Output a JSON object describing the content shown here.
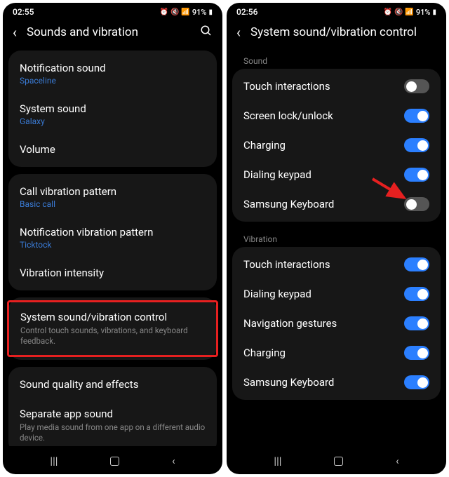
{
  "left": {
    "status": {
      "time": "02:55",
      "battery": "91%"
    },
    "header": {
      "title": "Sounds and vibration"
    },
    "groups": [
      [
        {
          "title": "Notification sound",
          "sub": "Spaceline"
        },
        {
          "title": "System sound",
          "sub": "Galaxy"
        },
        {
          "title": "Volume"
        }
      ],
      [
        {
          "title": "Call vibration pattern",
          "sub": "Basic call"
        },
        {
          "title": "Notification vibration pattern",
          "sub": "Ticktock"
        },
        {
          "title": "Vibration intensity"
        }
      ],
      [
        {
          "title": "System sound/vibration control",
          "desc": "Control touch sounds, vibrations, and keyboard feedback.",
          "highlighted": true
        }
      ],
      [
        {
          "title": "Sound quality and effects"
        },
        {
          "title": "Separate app sound",
          "desc": "Play media sound from one app on a different audio device."
        }
      ]
    ]
  },
  "right": {
    "status": {
      "time": "02:56",
      "battery": "91%"
    },
    "header": {
      "title": "System sound/vibration control"
    },
    "sections": [
      {
        "label": "Sound",
        "items": [
          {
            "title": "Touch interactions",
            "on": false
          },
          {
            "title": "Screen lock/unlock",
            "on": true
          },
          {
            "title": "Charging",
            "on": true
          },
          {
            "title": "Dialing keypad",
            "on": true
          },
          {
            "title": "Samsung Keyboard",
            "on": false,
            "arrow": true
          }
        ]
      },
      {
        "label": "Vibration",
        "items": [
          {
            "title": "Touch interactions",
            "on": true
          },
          {
            "title": "Dialing keypad",
            "on": true
          },
          {
            "title": "Navigation gestures",
            "on": true
          },
          {
            "title": "Charging",
            "on": true
          },
          {
            "title": "Samsung Keyboard",
            "on": true
          }
        ]
      }
    ]
  }
}
